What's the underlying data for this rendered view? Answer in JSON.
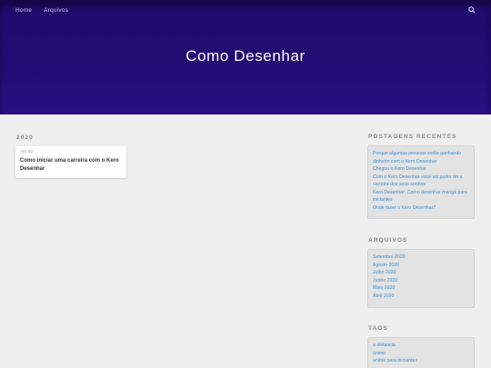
{
  "nav": {
    "home": "Home",
    "archives": "Arquivos"
  },
  "site": {
    "title": "Como Desenhar"
  },
  "main": {
    "year_heading": "2020",
    "post": {
      "date": "Abr 30",
      "title": "Como iniciar uma carreira com o Kero Desenhar"
    }
  },
  "sidebar": {
    "recent": {
      "heading": "POSTAGENS RECENTES",
      "items": [
        "Porque algumas pessoas estão ganhando dinheiro com o Kero Desenhar",
        "Chegou o Kero Desenhar",
        "Com o Kero Desenhar você vai poder ter a carreira dos seus sonhos",
        "Kero Desenhar: Como desenhar mangá para iniciantes",
        "Onde fazer o Kero Desenhar?"
      ]
    },
    "archives": {
      "heading": "ARQUIVOS",
      "items": [
        "Setembro 2020",
        "Agosto 2020",
        "Julho 2020",
        "Junho 2020",
        "Maio 2020",
        "Abril 2020"
      ]
    },
    "tags": {
      "heading": "TAGS",
      "items": [
        "a distancia",
        "anime",
        "anime para iniciantes"
      ]
    }
  },
  "colors": {
    "header": "#230c75",
    "link": "#3a8fd6",
    "background": "#efefef"
  }
}
